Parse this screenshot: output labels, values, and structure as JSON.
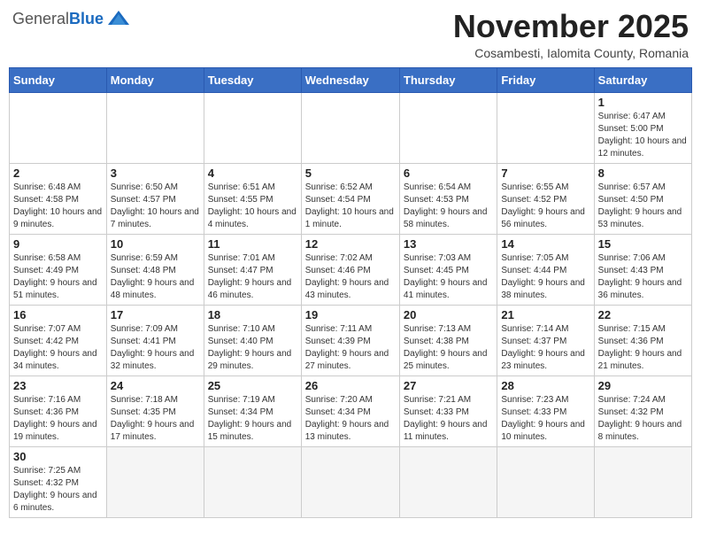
{
  "header": {
    "logo_general": "General",
    "logo_blue": "Blue",
    "month_title": "November 2025",
    "location": "Cosambesti, Ialomita County, Romania"
  },
  "weekdays": [
    "Sunday",
    "Monday",
    "Tuesday",
    "Wednesday",
    "Thursday",
    "Friday",
    "Saturday"
  ],
  "weeks": [
    [
      {
        "day": "",
        "info": ""
      },
      {
        "day": "",
        "info": ""
      },
      {
        "day": "",
        "info": ""
      },
      {
        "day": "",
        "info": ""
      },
      {
        "day": "",
        "info": ""
      },
      {
        "day": "",
        "info": ""
      },
      {
        "day": "1",
        "info": "Sunrise: 6:47 AM\nSunset: 5:00 PM\nDaylight: 10 hours and 12 minutes."
      }
    ],
    [
      {
        "day": "2",
        "info": "Sunrise: 6:48 AM\nSunset: 4:58 PM\nDaylight: 10 hours and 9 minutes."
      },
      {
        "day": "3",
        "info": "Sunrise: 6:50 AM\nSunset: 4:57 PM\nDaylight: 10 hours and 7 minutes."
      },
      {
        "day": "4",
        "info": "Sunrise: 6:51 AM\nSunset: 4:55 PM\nDaylight: 10 hours and 4 minutes."
      },
      {
        "day": "5",
        "info": "Sunrise: 6:52 AM\nSunset: 4:54 PM\nDaylight: 10 hours and 1 minute."
      },
      {
        "day": "6",
        "info": "Sunrise: 6:54 AM\nSunset: 4:53 PM\nDaylight: 9 hours and 58 minutes."
      },
      {
        "day": "7",
        "info": "Sunrise: 6:55 AM\nSunset: 4:52 PM\nDaylight: 9 hours and 56 minutes."
      },
      {
        "day": "8",
        "info": "Sunrise: 6:57 AM\nSunset: 4:50 PM\nDaylight: 9 hours and 53 minutes."
      }
    ],
    [
      {
        "day": "9",
        "info": "Sunrise: 6:58 AM\nSunset: 4:49 PM\nDaylight: 9 hours and 51 minutes."
      },
      {
        "day": "10",
        "info": "Sunrise: 6:59 AM\nSunset: 4:48 PM\nDaylight: 9 hours and 48 minutes."
      },
      {
        "day": "11",
        "info": "Sunrise: 7:01 AM\nSunset: 4:47 PM\nDaylight: 9 hours and 46 minutes."
      },
      {
        "day": "12",
        "info": "Sunrise: 7:02 AM\nSunset: 4:46 PM\nDaylight: 9 hours and 43 minutes."
      },
      {
        "day": "13",
        "info": "Sunrise: 7:03 AM\nSunset: 4:45 PM\nDaylight: 9 hours and 41 minutes."
      },
      {
        "day": "14",
        "info": "Sunrise: 7:05 AM\nSunset: 4:44 PM\nDaylight: 9 hours and 38 minutes."
      },
      {
        "day": "15",
        "info": "Sunrise: 7:06 AM\nSunset: 4:43 PM\nDaylight: 9 hours and 36 minutes."
      }
    ],
    [
      {
        "day": "16",
        "info": "Sunrise: 7:07 AM\nSunset: 4:42 PM\nDaylight: 9 hours and 34 minutes."
      },
      {
        "day": "17",
        "info": "Sunrise: 7:09 AM\nSunset: 4:41 PM\nDaylight: 9 hours and 32 minutes."
      },
      {
        "day": "18",
        "info": "Sunrise: 7:10 AM\nSunset: 4:40 PM\nDaylight: 9 hours and 29 minutes."
      },
      {
        "day": "19",
        "info": "Sunrise: 7:11 AM\nSunset: 4:39 PM\nDaylight: 9 hours and 27 minutes."
      },
      {
        "day": "20",
        "info": "Sunrise: 7:13 AM\nSunset: 4:38 PM\nDaylight: 9 hours and 25 minutes."
      },
      {
        "day": "21",
        "info": "Sunrise: 7:14 AM\nSunset: 4:37 PM\nDaylight: 9 hours and 23 minutes."
      },
      {
        "day": "22",
        "info": "Sunrise: 7:15 AM\nSunset: 4:36 PM\nDaylight: 9 hours and 21 minutes."
      }
    ],
    [
      {
        "day": "23",
        "info": "Sunrise: 7:16 AM\nSunset: 4:36 PM\nDaylight: 9 hours and 19 minutes."
      },
      {
        "day": "24",
        "info": "Sunrise: 7:18 AM\nSunset: 4:35 PM\nDaylight: 9 hours and 17 minutes."
      },
      {
        "day": "25",
        "info": "Sunrise: 7:19 AM\nSunset: 4:34 PM\nDaylight: 9 hours and 15 minutes."
      },
      {
        "day": "26",
        "info": "Sunrise: 7:20 AM\nSunset: 4:34 PM\nDaylight: 9 hours and 13 minutes."
      },
      {
        "day": "27",
        "info": "Sunrise: 7:21 AM\nSunset: 4:33 PM\nDaylight: 9 hours and 11 minutes."
      },
      {
        "day": "28",
        "info": "Sunrise: 7:23 AM\nSunset: 4:33 PM\nDaylight: 9 hours and 10 minutes."
      },
      {
        "day": "29",
        "info": "Sunrise: 7:24 AM\nSunset: 4:32 PM\nDaylight: 9 hours and 8 minutes."
      }
    ],
    [
      {
        "day": "30",
        "info": "Sunrise: 7:25 AM\nSunset: 4:32 PM\nDaylight: 9 hours and 6 minutes."
      },
      {
        "day": "",
        "info": ""
      },
      {
        "day": "",
        "info": ""
      },
      {
        "day": "",
        "info": ""
      },
      {
        "day": "",
        "info": ""
      },
      {
        "day": "",
        "info": ""
      },
      {
        "day": "",
        "info": ""
      }
    ]
  ]
}
